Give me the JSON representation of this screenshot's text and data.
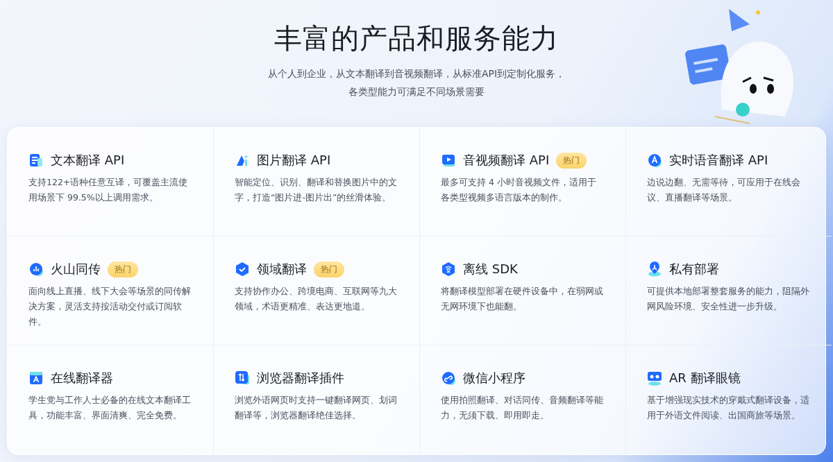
{
  "header": {
    "title": "丰富的产品和服务能力",
    "subtitle_lines": [
      "从个人到企业，从文本翻译到音视频翻译，从标准API到定制化服务，",
      "各类型能力可满足不同场景需要"
    ]
  },
  "products": [
    {
      "kind": "doc",
      "title": "文本翻译 API",
      "desc": "支持122+语种任意互译，可覆盖主流使用场景下 99.5%以上调用需求。"
    },
    {
      "kind": "image",
      "title": "图片翻译 API",
      "desc": "智能定位、识别、翻译和替换图片中的文字，打造“图片进-图片出”的丝滑体验。"
    },
    {
      "kind": "video",
      "title": "音视频翻译 API",
      "badge": "热门",
      "desc": "最多可支持 4 小时音视频文件，适用于各类型视频多语言版本的制作。"
    },
    {
      "kind": "voice",
      "title": "实时语音翻译 API",
      "desc": "边说边翻、无需等待，可应用于在线会议、直播翻译等场景。"
    },
    {
      "kind": "bars",
      "title": "火山同传",
      "badge": "热门",
      "desc": "面向线上直播、线下大会等场景的同传解决方案，灵活支持按活动交付或订阅软件。"
    },
    {
      "kind": "shield",
      "title": "领域翻译",
      "badge": "热门",
      "desc": "支持协作办公、跨境电商、互联网等九大领域，术语更精准、表达更地道。"
    },
    {
      "kind": "wifi",
      "title": "离线 SDK",
      "desc": "将翻译模型部署在硬件设备中，在弱网或无网环境下也能翻。"
    },
    {
      "kind": "pin",
      "title": "私有部署",
      "desc": "可提供本地部署整套服务的能力，阻隔外网风险环境、安全性进一步升级。"
    },
    {
      "kind": "web",
      "title": "在线翻译器",
      "desc": "学生党与工作人士必备的在线文本翻译工具，功能丰富、界面清爽、完全免费。"
    },
    {
      "kind": "plugin",
      "title": "浏览器翻译插件",
      "desc": "浏览外语网页时支持一键翻译网页、划词翻译等，浏览器翻译绝佳选择。"
    },
    {
      "kind": "link",
      "title": "微信小程序",
      "desc": "使用拍照翻译、对话同传、音频翻译等能力，无须下载、即用即走。"
    },
    {
      "kind": "ar",
      "title": "AR 翻译眼镜",
      "desc": "基于增强现实技术的穿戴式翻译设备，适用于外语文件阅读、出国商旅等场景。"
    }
  ]
}
